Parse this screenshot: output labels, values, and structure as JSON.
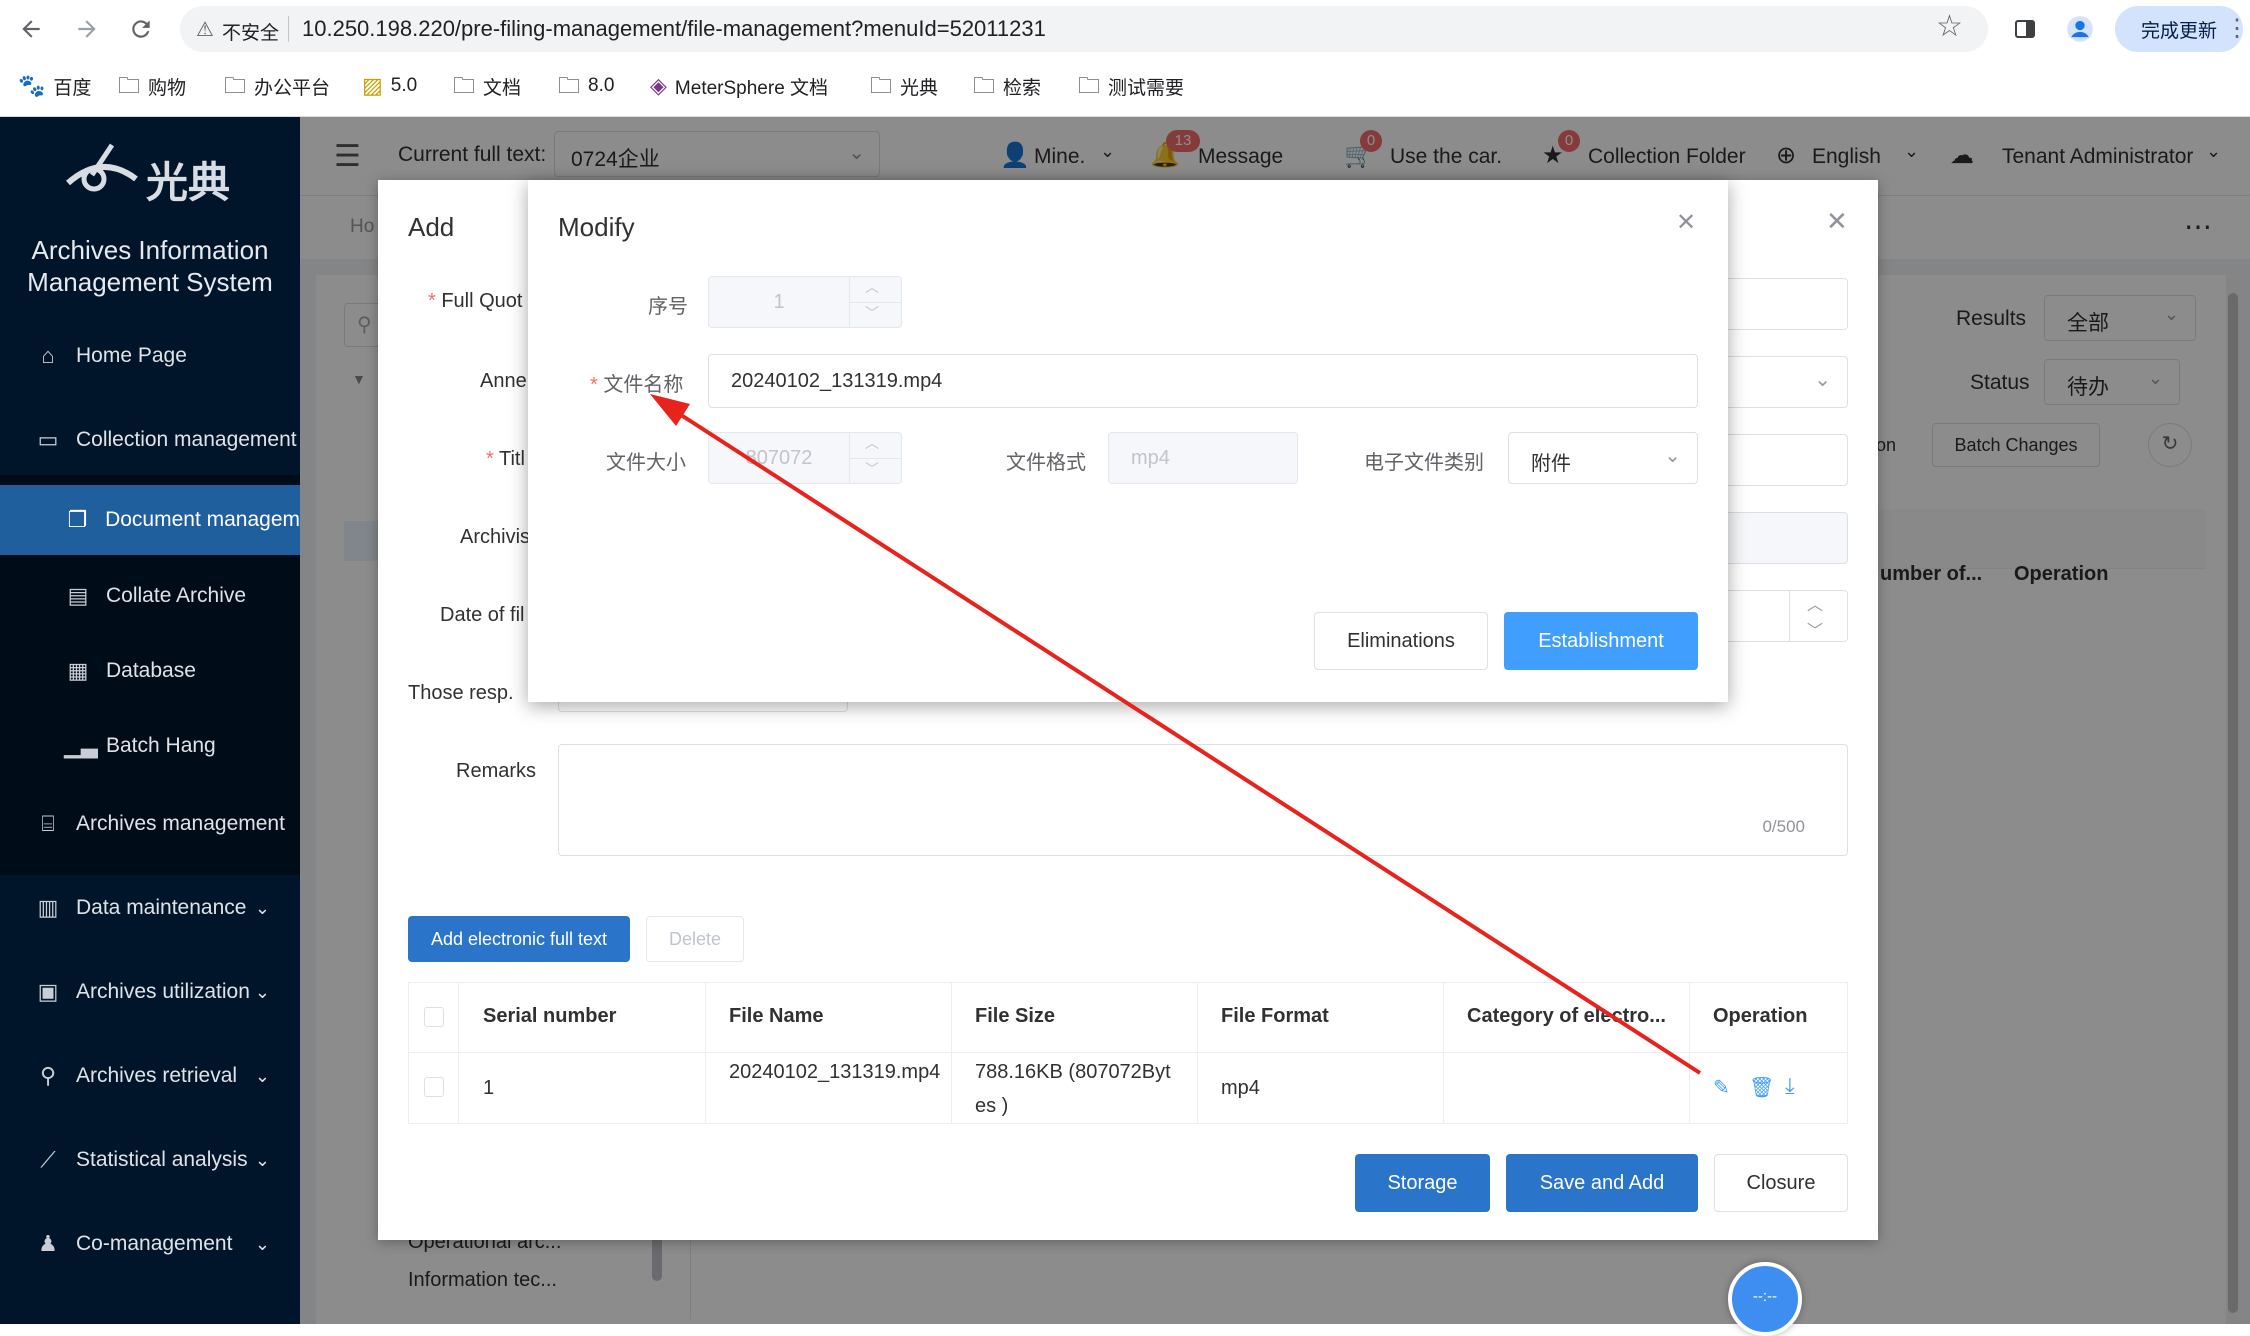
{
  "browser": {
    "security_label": "不安全",
    "url": "10.250.198.220/pre-filing-management/file-management?menuId=52011231",
    "update_label": "完成更新",
    "bookmarks": [
      "百度",
      "购物",
      "办公平台",
      "5.0",
      "文档",
      "8.0",
      "MeterSphere 文档",
      "光典",
      "检索",
      "测试需要"
    ]
  },
  "sidebar": {
    "logo_text": "光典",
    "system_title_line1": "Archives Information",
    "system_title_line2": "Management System",
    "items": [
      {
        "label": "Home Page",
        "icon": "home-icon"
      },
      {
        "label": "Collection management",
        "icon": "folder-icon"
      },
      {
        "label": "Document managem",
        "icon": "document-icon"
      },
      {
        "label": "Collate Archive",
        "icon": "file-icon"
      },
      {
        "label": "Database",
        "icon": "calendar-icon"
      },
      {
        "label": "Batch Hang",
        "icon": "bar-chart-icon"
      },
      {
        "label": "Archives management",
        "icon": "bank-icon"
      },
      {
        "label": "Data maintenance",
        "icon": "building-icon"
      },
      {
        "label": "Archives utilization",
        "icon": "clipboard-icon"
      },
      {
        "label": "Archives retrieval",
        "icon": "search-icon"
      },
      {
        "label": "Statistical analysis",
        "icon": "line-chart-icon"
      },
      {
        "label": "Co-management",
        "icon": "user-icon"
      }
    ]
  },
  "header": {
    "fulltext_label": "Current full text:",
    "fulltext_value": "0724企业",
    "mine": "Mine.",
    "message": "Message",
    "message_badge": "13",
    "cart": "Use the car.",
    "cart_badge": "0",
    "collection": "Collection Folder",
    "collection_badge": "0",
    "language": "English",
    "tenant": "Tenant Administrator"
  },
  "background": {
    "home_tab": "Ho",
    "results_label": "Results",
    "results_value": "全部",
    "status_label": "Status",
    "status_value": "待办",
    "on_fragment": "on",
    "batch_changes": "Batch Changes",
    "number_of": "umber of...",
    "operation": "Operation",
    "tree_item1": "Operational arc...",
    "tree_item2": "Information tec..."
  },
  "add_dialog": {
    "title": "Add",
    "labels": {
      "full_quote": "Full Quot",
      "annex": "Anne",
      "title": "Titl",
      "archivist": "Archivis",
      "date": "Date of fil",
      "responsible": "Those resp.",
      "remarks": "Remarks"
    },
    "remarks_count": "0/500",
    "add_button": "Add electronic full text",
    "delete_button": "Delete",
    "table": {
      "headers": [
        "Serial number",
        "File Name",
        "File Size",
        "File Format",
        "Category of electro...",
        "Operation"
      ],
      "rows": [
        {
          "serial": "1",
          "file_name": "20240102_131319.mp4",
          "file_size": "788.16KB (807072Bytes )",
          "file_format": "mp4",
          "category": ""
        }
      ]
    },
    "storage_button": "Storage",
    "save_add_button": "Save and Add",
    "closure_button": "Closure"
  },
  "modify_dialog": {
    "title": "Modify",
    "serial_label": "序号",
    "serial_value": "1",
    "filename_label": "文件名称",
    "filename_value": "20240102_131319.mp4",
    "filesize_label": "文件大小",
    "filesize_value": "807072",
    "format_label": "文件格式",
    "format_value": "mp4",
    "category_label": "电子文件类别",
    "category_value": "附件",
    "cancel_button": "Eliminations",
    "confirm_button": "Establishment"
  },
  "floating": {
    "clock_text": "--:--"
  },
  "colors": {
    "primary": "#409eff",
    "primary_dark": "#2a74c9",
    "sidebar": "#001529",
    "active": "#1f5f9e",
    "arrow": "#e8231c"
  }
}
